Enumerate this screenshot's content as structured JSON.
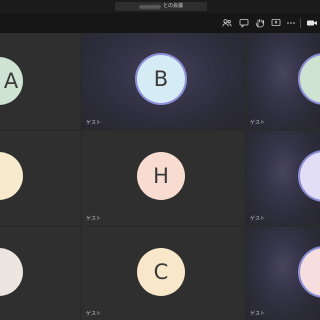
{
  "window": {
    "title": "との会議"
  },
  "toolbar": {
    "icons": [
      "participants-icon",
      "chat-icon",
      "raise-hand-icon",
      "share-screen-icon",
      "more-options-icon",
      "camera-icon"
    ]
  },
  "participants": [
    {
      "initial": "A",
      "label": ""
    },
    {
      "initial": "B",
      "label": "ゲスト",
      "color": "#d6ecf5"
    },
    {
      "initial": "",
      "label": "ゲスト",
      "color": "#cfe3d2"
    },
    {
      "initial": "",
      "label": "",
      "color": "#f7ebcc"
    },
    {
      "initial": "H",
      "label": "ゲスト",
      "color": "#f8dcd2"
    },
    {
      "initial": "",
      "label": "ゲスト",
      "color": "#e2def5"
    },
    {
      "initial": "",
      "label": "",
      "color": "#ece5e0"
    },
    {
      "initial": "C",
      "label": "ゲスト",
      "color": "#f8e7c8"
    },
    {
      "initial": "",
      "label": "ゲスト",
      "color": "#f6dede"
    }
  ]
}
